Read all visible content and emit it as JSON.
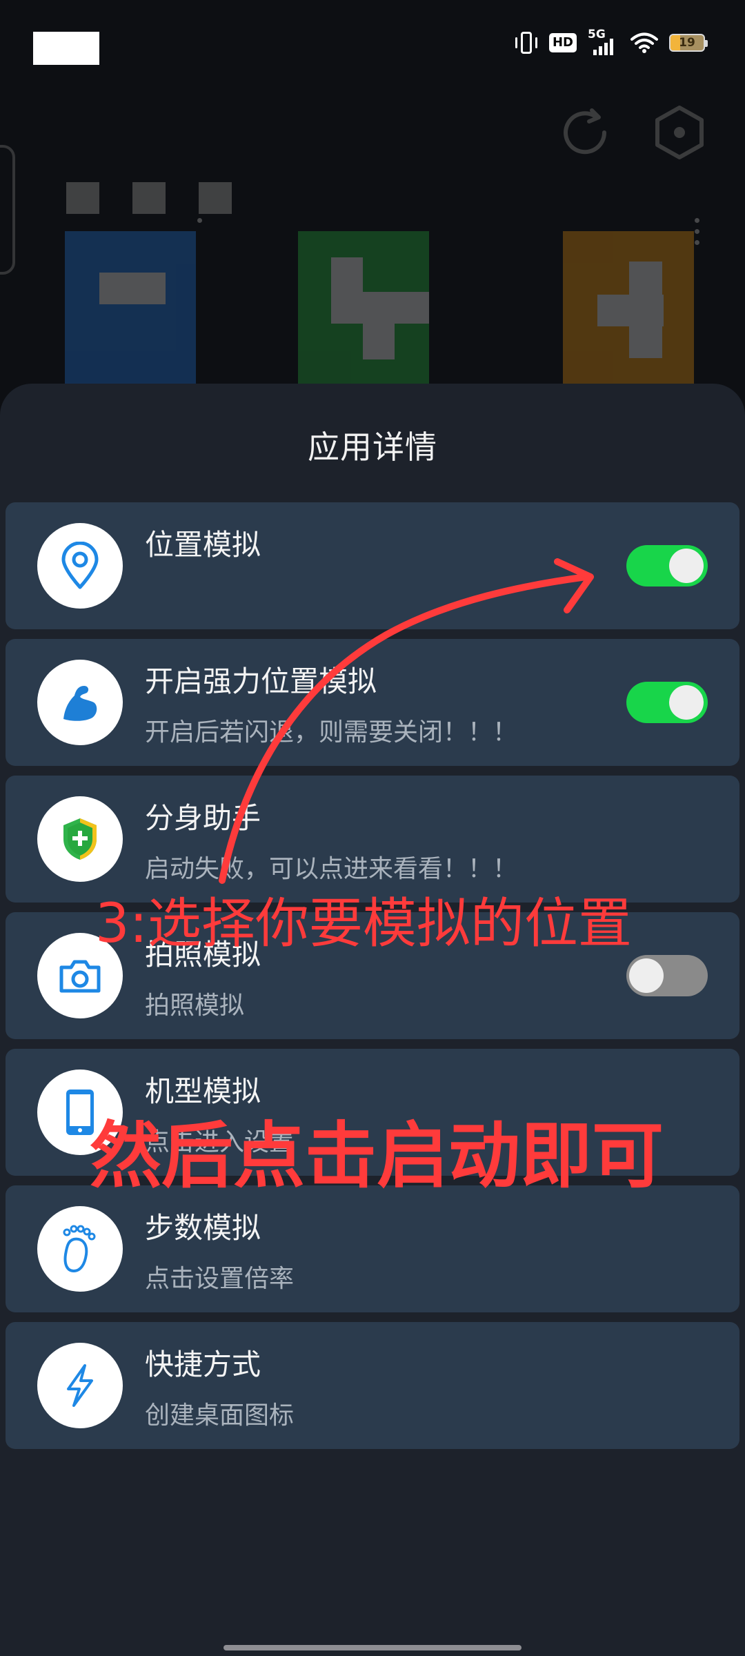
{
  "status_bar": {
    "hd_label": "HD",
    "network_label": "5G",
    "battery_level": "19"
  },
  "sheet": {
    "title": "应用详情"
  },
  "items": [
    {
      "title": "位置模拟",
      "subtitle": "",
      "icon": "location-pin-icon",
      "toggle": "on"
    },
    {
      "title": "开启强力位置模拟",
      "subtitle": "开启后若闪退，则需要关闭！！！",
      "icon": "flexed-arm-icon",
      "toggle": "on"
    },
    {
      "title": "分身助手",
      "subtitle": "启动失败，可以点进来看看！！！",
      "icon": "shield-plus-icon",
      "toggle": null
    },
    {
      "title": "拍照模拟",
      "subtitle": "拍照模拟",
      "icon": "camera-icon",
      "toggle": "off"
    },
    {
      "title": "机型模拟",
      "subtitle": "点击进入设置",
      "icon": "phone-icon",
      "toggle": null
    },
    {
      "title": "步数模拟",
      "subtitle": "点击设置倍率",
      "icon": "footprint-icon",
      "toggle": null
    },
    {
      "title": "快捷方式",
      "subtitle": "创建桌面图标",
      "icon": "lightning-icon",
      "toggle": null
    }
  ],
  "annotations": {
    "step_text": "3:选择你要模拟的位置",
    "action_text": "然后点击启动即可"
  },
  "colors": {
    "sheet_bg": "#1d222b",
    "card_bg": "#2b3b4d",
    "toggle_on": "#18d54a",
    "toggle_off": "#8a8a8a",
    "annotation": "#ff3b3b",
    "icon_blue": "#1e88e5"
  }
}
